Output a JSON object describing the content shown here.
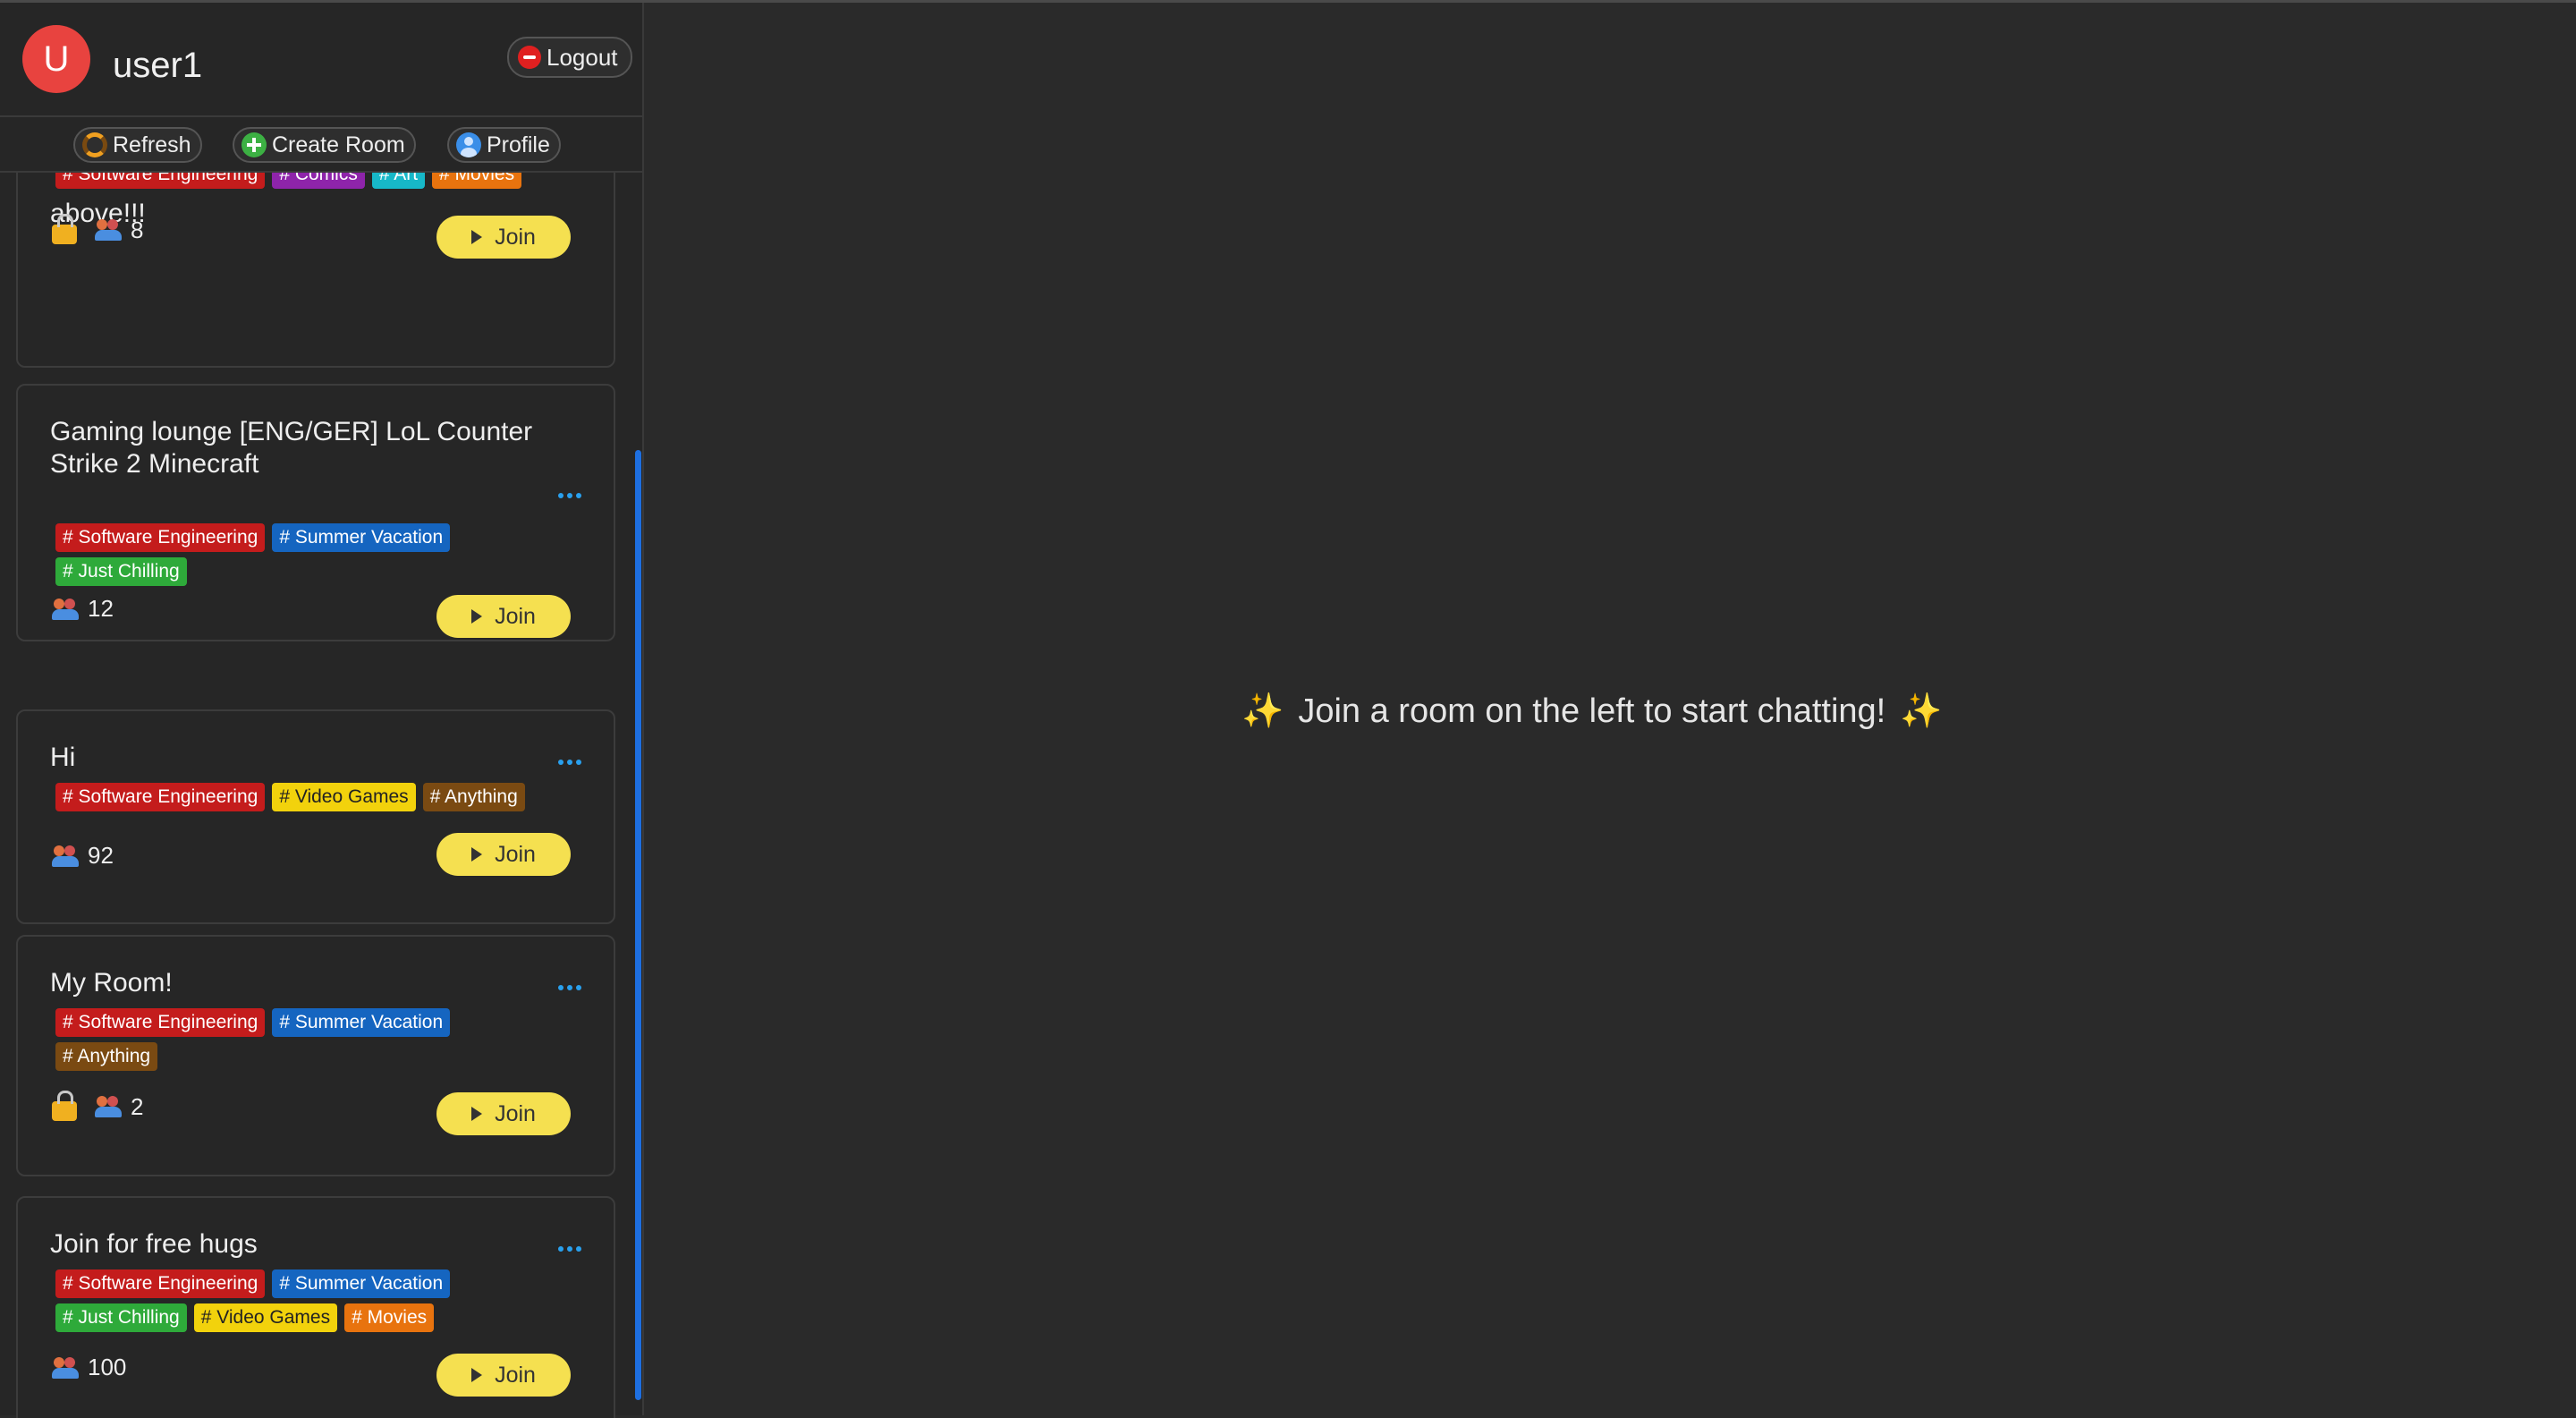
{
  "user": {
    "initial": "U",
    "name": "user1"
  },
  "header": {
    "logout_label": "Logout"
  },
  "toolbar": {
    "refresh_label": "Refresh",
    "create_label": "Create Room",
    "profile_label": "Profile"
  },
  "icons": [
    "stop-icon",
    "refresh-icon",
    "plus-icon",
    "profile-icon",
    "more-icon",
    "lock-icon",
    "people-icon",
    "play-icon",
    "sparkle-icon"
  ],
  "tag_colors": {
    "Software Engineering": "#c41c1c",
    "Comics": "#8e24aa",
    "Art": "#17b8c8",
    "Movies": "#e8730e",
    "Summer Vacation": "#1565c0",
    "Just Chilling": "#2eaa3a",
    "Video Games": "#f2d20c",
    "Anything": "#7a4a12"
  },
  "rooms": [
    {
      "title": "above!!!",
      "tags": [
        "# Software Engineering",
        "# Comics",
        "# Art",
        "# Movies"
      ],
      "locked": true,
      "count": "8",
      "join_label": "Join"
    },
    {
      "title": "Gaming lounge [ENG/GER] LoL Counter Strike 2 Minecraft",
      "tags": [
        "# Software Engineering",
        "# Summer Vacation",
        "# Just Chilling"
      ],
      "locked": false,
      "count": "12",
      "join_label": "Join"
    },
    {
      "title": "Hi",
      "tags": [
        "# Software Engineering",
        "# Video Games",
        "# Anything"
      ],
      "locked": false,
      "count": "92",
      "join_label": "Join"
    },
    {
      "title": "My Room!",
      "tags": [
        "# Software Engineering",
        "# Summer Vacation",
        "# Anything"
      ],
      "locked": true,
      "count": "2",
      "join_label": "Join"
    },
    {
      "title": "Join for free hugs",
      "tags": [
        "# Software Engineering",
        "# Summer Vacation",
        "# Just Chilling",
        "# Video Games",
        "# Movies"
      ],
      "locked": false,
      "count": "100",
      "join_label": "Join"
    }
  ],
  "main": {
    "message": "Join a room on the left to start chatting!"
  }
}
